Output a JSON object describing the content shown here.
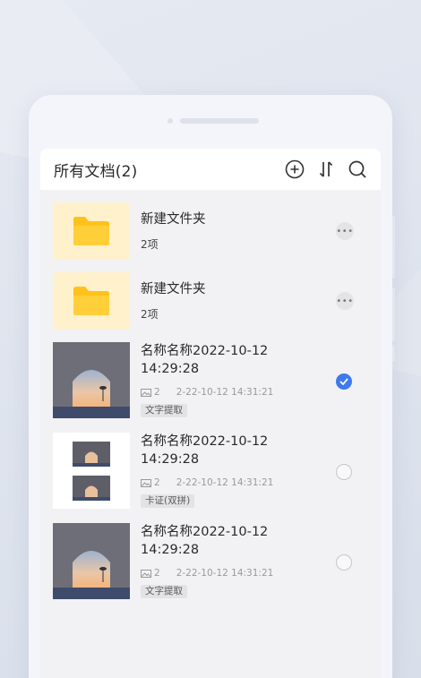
{
  "header": {
    "title": "所有文档(2)",
    "icons": [
      "add-circle-icon",
      "sort-icon",
      "search-icon"
    ]
  },
  "folders": [
    {
      "name": "新建文件夹",
      "count": "2项"
    },
    {
      "name": "新建文件夹",
      "count": "2项"
    }
  ],
  "documents": [
    {
      "name_line1": "名称名称2022-10-12",
      "name_line2": "14:29:28",
      "pages": "2",
      "date": "2-22-10-12  14:31:21",
      "tag": "文字提取",
      "selected": true
    },
    {
      "name_line1": "名称名称2022-10-12",
      "name_line2": "14:29:28",
      "pages": "2",
      "date": "2-22-10-12  14:31:21",
      "tag": "卡证(双拼)",
      "selected": false
    },
    {
      "name_line1": "名称名称2022-10-12",
      "name_line2": "14:29:28",
      "pages": "2",
      "date": "2-22-10-12  14:31:21",
      "tag": "文字提取",
      "selected": false
    }
  ],
  "colors": {
    "accent": "#3e79ee",
    "folder_bg": "#fff1cc",
    "folder": "#ffc21a"
  }
}
